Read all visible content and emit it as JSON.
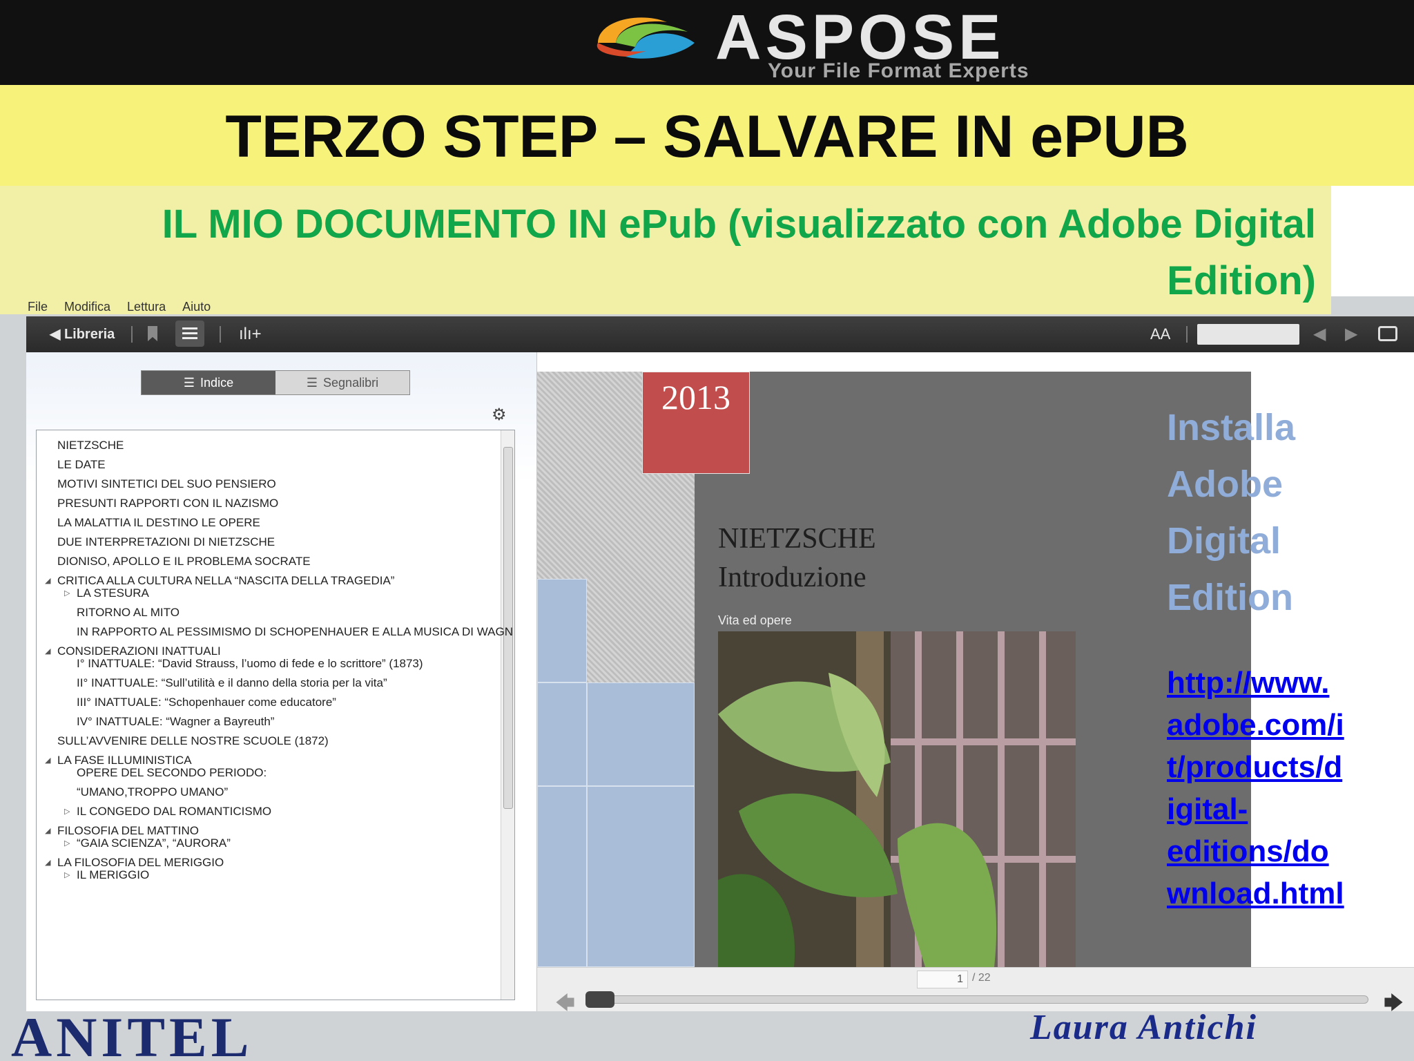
{
  "brand": {
    "name": "ASPOSE",
    "tagline": "Your File Format Experts",
    "accent": "#f6f27a"
  },
  "slide": {
    "title": "TERZO STEP – SALVARE IN ePUB",
    "subtitle_line1": "IL MIO DOCUMENTO IN ePub (visualizzato con Adobe Digital",
    "subtitle_line2": "Edition)",
    "subtitle_color": "#12a64a"
  },
  "menubar": {
    "items": [
      "File",
      "Modifica",
      "Lettura",
      "Aiuto"
    ]
  },
  "toolbar": {
    "back_label": "◀ Libreria",
    "chart_icon": "ılı+",
    "font_icon": "AA",
    "prev_icon": "◀",
    "next_icon": "▶"
  },
  "sidebar": {
    "tab_index": "Indice",
    "tab_bookmarks": "Segnalibri",
    "toc": [
      {
        "label": "NIETZSCHE",
        "level": 0
      },
      {
        "label": "LE DATE",
        "level": 0
      },
      {
        "label": "MOTIVI SINTETICI DEL SUO PENSIERO",
        "level": 0
      },
      {
        "label": "PRESUNTI RAPPORTI CON IL NAZISMO",
        "level": 0
      },
      {
        "label": "LA MALATTIA IL DESTINO LE OPERE",
        "level": 0
      },
      {
        "label": "DUE INTERPRETAZIONI DI NIETZSCHE",
        "level": 0
      },
      {
        "label": "DIONISO, APOLLO E IL PROBLEMA SOCRATE",
        "level": 0
      },
      {
        "label": "CRITICA ALLA CULTURA NELLA “NASCITA DELLA TRAGEDIA”",
        "level": 0,
        "expanded": true
      },
      {
        "label": "LA STESURA",
        "level": 1,
        "collapsed": true
      },
      {
        "label": "RITORNO AL MITO",
        "level": 1
      },
      {
        "label": "IN RAPPORTO AL PESSIMISMO DI SCHOPENHAUER E ALLA MUSICA DI WAGN",
        "level": 1
      },
      {
        "label": "CONSIDERAZIONI INATTUALI",
        "level": 0,
        "expanded": true
      },
      {
        "label": "I° INATTUALE: “David Strauss, l’uomo di fede e lo scrittore” (1873)",
        "level": 1
      },
      {
        "label": "II° INATTUALE: “Sull’utilità e il danno della storia per la vita”",
        "level": 1
      },
      {
        "label": "III° INATTUALE: “Schopenhauer come educatore”",
        "level": 1
      },
      {
        "label": "IV° INATTUALE: “Wagner a Bayreuth”",
        "level": 1
      },
      {
        "label": "SULL’AVVENIRE DELLE NOSTRE SCUOLE (1872)",
        "level": 0
      },
      {
        "label": "LA FASE ILLUMINISTICA",
        "level": 0,
        "expanded": true
      },
      {
        "label": "OPERE DEL SECONDO PERIODO:",
        "level": 1
      },
      {
        "label": "“UMANO,TROPPO UMANO”",
        "level": 1
      },
      {
        "label": "IL CONGEDO DAL ROMANTICISMO",
        "level": 1,
        "collapsed": true
      },
      {
        "label": "FILOSOFIA DEL MATTINO",
        "level": 0,
        "expanded": true
      },
      {
        "label": "“GAIA SCIENZA”, “AURORA”",
        "level": 1,
        "collapsed": true
      },
      {
        "label": "LA FILOSOFIA DEL MERIGGIO",
        "level": 0,
        "expanded": true
      },
      {
        "label": "IL MERIGGIO",
        "level": 1,
        "collapsed": true
      }
    ]
  },
  "cover": {
    "year": "2013",
    "title_line1": "NIETZSCHE",
    "title_line2": "Introduzione",
    "subtitle": "Vita ed opere"
  },
  "callout": {
    "install_lines": [
      "Installa",
      "Adobe",
      "Digital",
      "Edition"
    ],
    "link_lines": [
      "http://www.",
      "adobe.com/i",
      "t/products/d",
      "igital-",
      "editions/do",
      "wnload.html"
    ]
  },
  "pager": {
    "current_page": "1",
    "total": "/ 22",
    "progress": 0.0
  },
  "footer": {
    "left_logo": "ANITEL",
    "right_logo": "Laura Antichi"
  }
}
